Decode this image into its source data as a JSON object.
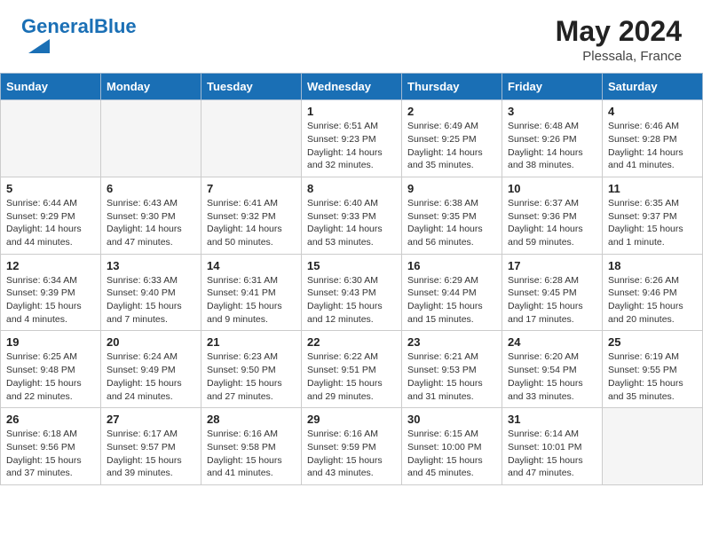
{
  "header": {
    "logo_text_general": "General",
    "logo_text_blue": "Blue",
    "month_year": "May 2024",
    "location": "Plessala, France"
  },
  "calendar": {
    "days_of_week": [
      "Sunday",
      "Monday",
      "Tuesday",
      "Wednesday",
      "Thursday",
      "Friday",
      "Saturday"
    ],
    "weeks": [
      [
        {
          "day": "",
          "info": ""
        },
        {
          "day": "",
          "info": ""
        },
        {
          "day": "",
          "info": ""
        },
        {
          "day": "1",
          "info": "Sunrise: 6:51 AM\nSunset: 9:23 PM\nDaylight: 14 hours and 32 minutes."
        },
        {
          "day": "2",
          "info": "Sunrise: 6:49 AM\nSunset: 9:25 PM\nDaylight: 14 hours and 35 minutes."
        },
        {
          "day": "3",
          "info": "Sunrise: 6:48 AM\nSunset: 9:26 PM\nDaylight: 14 hours and 38 minutes."
        },
        {
          "day": "4",
          "info": "Sunrise: 6:46 AM\nSunset: 9:28 PM\nDaylight: 14 hours and 41 minutes."
        }
      ],
      [
        {
          "day": "5",
          "info": "Sunrise: 6:44 AM\nSunset: 9:29 PM\nDaylight: 14 hours and 44 minutes."
        },
        {
          "day": "6",
          "info": "Sunrise: 6:43 AM\nSunset: 9:30 PM\nDaylight: 14 hours and 47 minutes."
        },
        {
          "day": "7",
          "info": "Sunrise: 6:41 AM\nSunset: 9:32 PM\nDaylight: 14 hours and 50 minutes."
        },
        {
          "day": "8",
          "info": "Sunrise: 6:40 AM\nSunset: 9:33 PM\nDaylight: 14 hours and 53 minutes."
        },
        {
          "day": "9",
          "info": "Sunrise: 6:38 AM\nSunset: 9:35 PM\nDaylight: 14 hours and 56 minutes."
        },
        {
          "day": "10",
          "info": "Sunrise: 6:37 AM\nSunset: 9:36 PM\nDaylight: 14 hours and 59 minutes."
        },
        {
          "day": "11",
          "info": "Sunrise: 6:35 AM\nSunset: 9:37 PM\nDaylight: 15 hours and 1 minute."
        }
      ],
      [
        {
          "day": "12",
          "info": "Sunrise: 6:34 AM\nSunset: 9:39 PM\nDaylight: 15 hours and 4 minutes."
        },
        {
          "day": "13",
          "info": "Sunrise: 6:33 AM\nSunset: 9:40 PM\nDaylight: 15 hours and 7 minutes."
        },
        {
          "day": "14",
          "info": "Sunrise: 6:31 AM\nSunset: 9:41 PM\nDaylight: 15 hours and 9 minutes."
        },
        {
          "day": "15",
          "info": "Sunrise: 6:30 AM\nSunset: 9:43 PM\nDaylight: 15 hours and 12 minutes."
        },
        {
          "day": "16",
          "info": "Sunrise: 6:29 AM\nSunset: 9:44 PM\nDaylight: 15 hours and 15 minutes."
        },
        {
          "day": "17",
          "info": "Sunrise: 6:28 AM\nSunset: 9:45 PM\nDaylight: 15 hours and 17 minutes."
        },
        {
          "day": "18",
          "info": "Sunrise: 6:26 AM\nSunset: 9:46 PM\nDaylight: 15 hours and 20 minutes."
        }
      ],
      [
        {
          "day": "19",
          "info": "Sunrise: 6:25 AM\nSunset: 9:48 PM\nDaylight: 15 hours and 22 minutes."
        },
        {
          "day": "20",
          "info": "Sunrise: 6:24 AM\nSunset: 9:49 PM\nDaylight: 15 hours and 24 minutes."
        },
        {
          "day": "21",
          "info": "Sunrise: 6:23 AM\nSunset: 9:50 PM\nDaylight: 15 hours and 27 minutes."
        },
        {
          "day": "22",
          "info": "Sunrise: 6:22 AM\nSunset: 9:51 PM\nDaylight: 15 hours and 29 minutes."
        },
        {
          "day": "23",
          "info": "Sunrise: 6:21 AM\nSunset: 9:53 PM\nDaylight: 15 hours and 31 minutes."
        },
        {
          "day": "24",
          "info": "Sunrise: 6:20 AM\nSunset: 9:54 PM\nDaylight: 15 hours and 33 minutes."
        },
        {
          "day": "25",
          "info": "Sunrise: 6:19 AM\nSunset: 9:55 PM\nDaylight: 15 hours and 35 minutes."
        }
      ],
      [
        {
          "day": "26",
          "info": "Sunrise: 6:18 AM\nSunset: 9:56 PM\nDaylight: 15 hours and 37 minutes."
        },
        {
          "day": "27",
          "info": "Sunrise: 6:17 AM\nSunset: 9:57 PM\nDaylight: 15 hours and 39 minutes."
        },
        {
          "day": "28",
          "info": "Sunrise: 6:16 AM\nSunset: 9:58 PM\nDaylight: 15 hours and 41 minutes."
        },
        {
          "day": "29",
          "info": "Sunrise: 6:16 AM\nSunset: 9:59 PM\nDaylight: 15 hours and 43 minutes."
        },
        {
          "day": "30",
          "info": "Sunrise: 6:15 AM\nSunset: 10:00 PM\nDaylight: 15 hours and 45 minutes."
        },
        {
          "day": "31",
          "info": "Sunrise: 6:14 AM\nSunset: 10:01 PM\nDaylight: 15 hours and 47 minutes."
        },
        {
          "day": "",
          "info": ""
        }
      ]
    ]
  }
}
